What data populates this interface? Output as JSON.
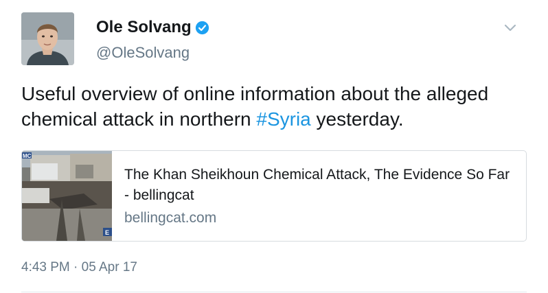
{
  "author": {
    "name": "Ole Solvang",
    "handle": "@OleSolvang",
    "verified": true
  },
  "tweet": {
    "text_before": "Useful overview of online information about the alleged chemical attack in northern ",
    "hashtag": "#Syria",
    "text_after": " yesterday."
  },
  "card": {
    "title": "The Khan Sheikhoun Chemical Attack, The Evidence So Far - bellingcat",
    "domain": "bellingcat.com",
    "image_overlay_tl": "MC",
    "image_overlay_br": "E"
  },
  "timestamp": "4:43 PM · 05 Apr 17",
  "colors": {
    "link": "#1b95e0",
    "verified_badge": "#1da1f2",
    "secondary_text": "#657786"
  },
  "icons": {
    "verified": "verified-badge-icon",
    "menu": "chevron-down-icon"
  }
}
